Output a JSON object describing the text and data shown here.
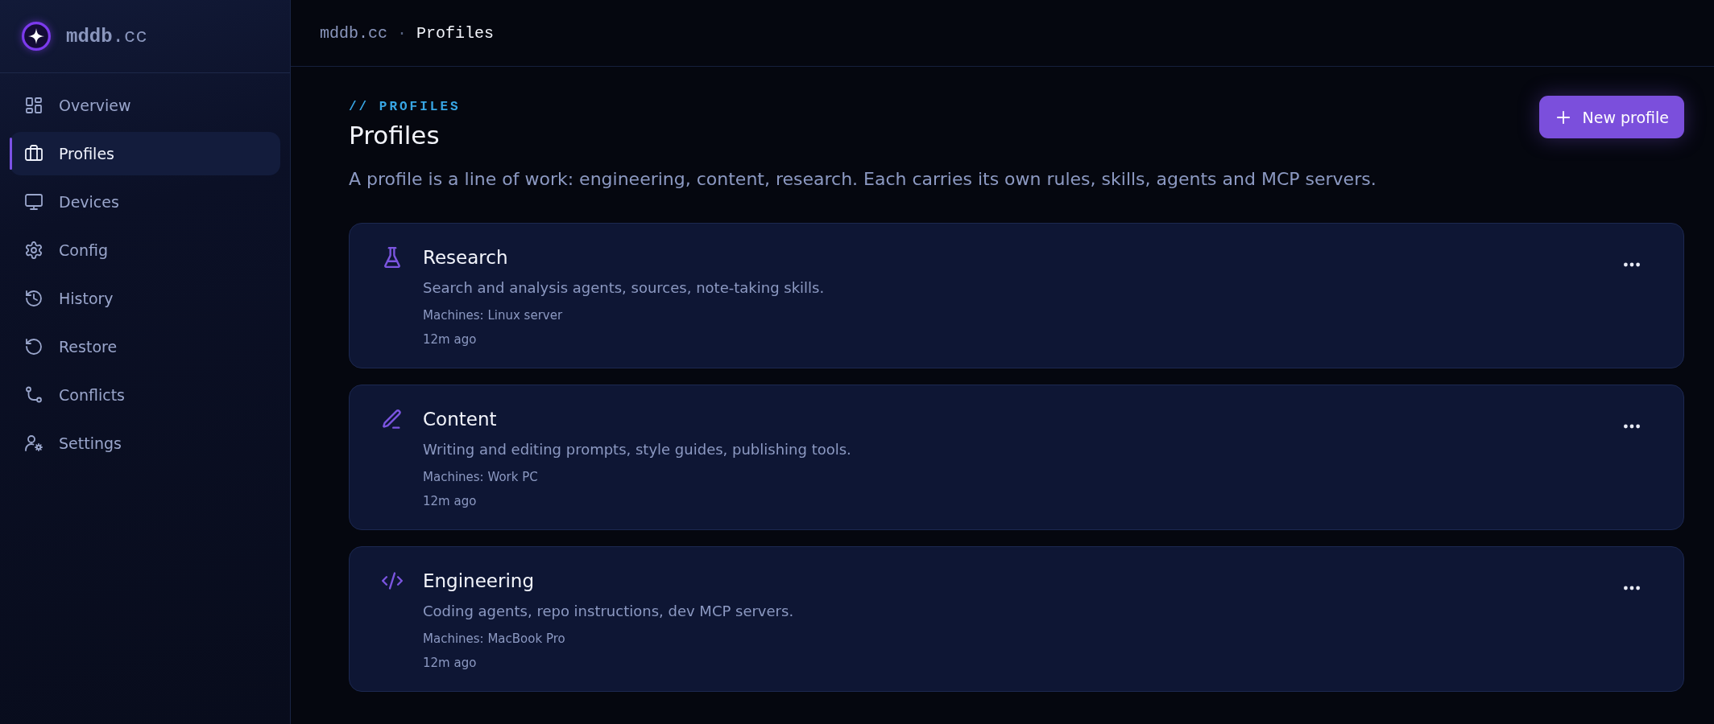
{
  "sidebar": {
    "brand": "**mddb**.cc",
    "items": [
      {
        "label": "Overview",
        "selected": false
      },
      {
        "label": "Profiles",
        "selected": true
      },
      {
        "label": "Devices",
        "selected": false
      },
      {
        "label": "Config",
        "selected": false
      },
      {
        "label": "History",
        "selected": false
      },
      {
        "label": "Restore",
        "selected": false
      },
      {
        "label": "Conflicts",
        "selected": false
      },
      {
        "label": "Settings",
        "selected": false
      }
    ]
  },
  "breadcrumb": {
    "separator": "·",
    "items": [
      {
        "label": "mddb.cc",
        "current": false
      },
      {
        "label": "Profiles",
        "current": true
      }
    ]
  },
  "header": {
    "eyebrow": "// PROFILES",
    "title": "Profiles",
    "description": "A profile is a line of work: engineering, content, research. Each carries its own rules, skills, agents and MCP servers.",
    "button": "New profile"
  },
  "profiles": [
    {
      "name": "Research",
      "description": "Search and analysis agents, sources, note-taking skills.",
      "machines": "Machines: Linux server",
      "updated": "12m ago"
    },
    {
      "name": "Content",
      "description": "Writing and editing prompts, style guides, publishing tools.",
      "machines": "Machines: Work PC",
      "updated": "12m ago"
    },
    {
      "name": "Engineering",
      "description": "Coding agents, repo instructions, dev MCP servers.",
      "machines": "Machines: MacBook Pro",
      "updated": "12m ago"
    }
  ]
}
